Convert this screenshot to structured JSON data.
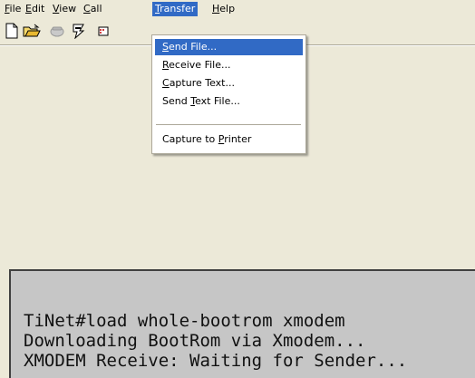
{
  "menubar": {
    "items": [
      {
        "accel": "F",
        "rest": "ile"
      },
      {
        "accel": "E",
        "rest": "dit"
      },
      {
        "accel": "V",
        "rest": "iew"
      },
      {
        "accel": "C",
        "rest": "all"
      },
      {
        "accel": "T",
        "rest": "ransfer"
      },
      {
        "accel": "H",
        "rest": "elp"
      }
    ]
  },
  "toolbar": {
    "icons": [
      "new-file-icon",
      "open-folder-icon",
      "disconnect-phone-icon",
      "connect-phone-icon",
      "properties-icon"
    ]
  },
  "transfer_menu": {
    "items": [
      {
        "pre": "",
        "accel": "S",
        "post": "end File..."
      },
      {
        "pre": "",
        "accel": "R",
        "post": "eceive File..."
      },
      {
        "pre": "",
        "accel": "C",
        "post": "apture Text..."
      },
      {
        "pre": "Send ",
        "accel": "T",
        "post": "ext File..."
      },
      {
        "pre": "Capture to ",
        "accel": "P",
        "post": "rinter"
      }
    ]
  },
  "terminal": {
    "lines": [
      "TiNet#load whole-bootrom xmodem",
      "Downloading BootRom via Xmodem...",
      "XMODEM Receive: Waiting for Sender..."
    ]
  },
  "colors": {
    "menu_highlight": "#316ac5",
    "window_bg": "#ece9d8",
    "terminal_bg": "#c6c6c6"
  }
}
